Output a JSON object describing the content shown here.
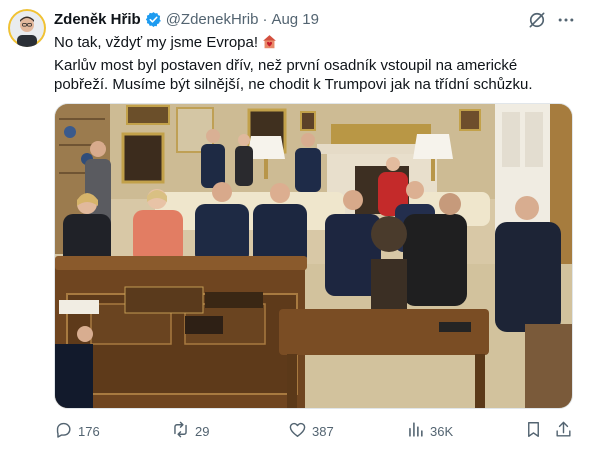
{
  "author": {
    "display_name": "Zdeněk Hřib",
    "handle": "@ZdenekHrib",
    "separator": "·",
    "date": "Aug 19"
  },
  "post": {
    "lines": [
      "No tak, vždyť my jsme Evropa!",
      "Karlův most byl postaven dřív, než první osadník vstoupil na americké",
      "pobřeží. Musíme být silnější, ne chodit k Trumpovi jak na třídní schůzku."
    ],
    "emoji": "house-with-heart"
  },
  "stats": {
    "replies": "176",
    "reposts": "29",
    "likes": "387",
    "views": "36K"
  },
  "icons": {
    "verified": "verified-badge-icon",
    "grok": "grok-icon",
    "more": "more-icon",
    "reply": "reply-icon",
    "repost": "repost-icon",
    "like": "like-icon",
    "views": "views-icon",
    "bookmark": "bookmark-icon",
    "share": "share-icon"
  },
  "colors": {
    "text": "#0f1419",
    "secondary": "#536471",
    "verified": "#1d9bf0"
  }
}
